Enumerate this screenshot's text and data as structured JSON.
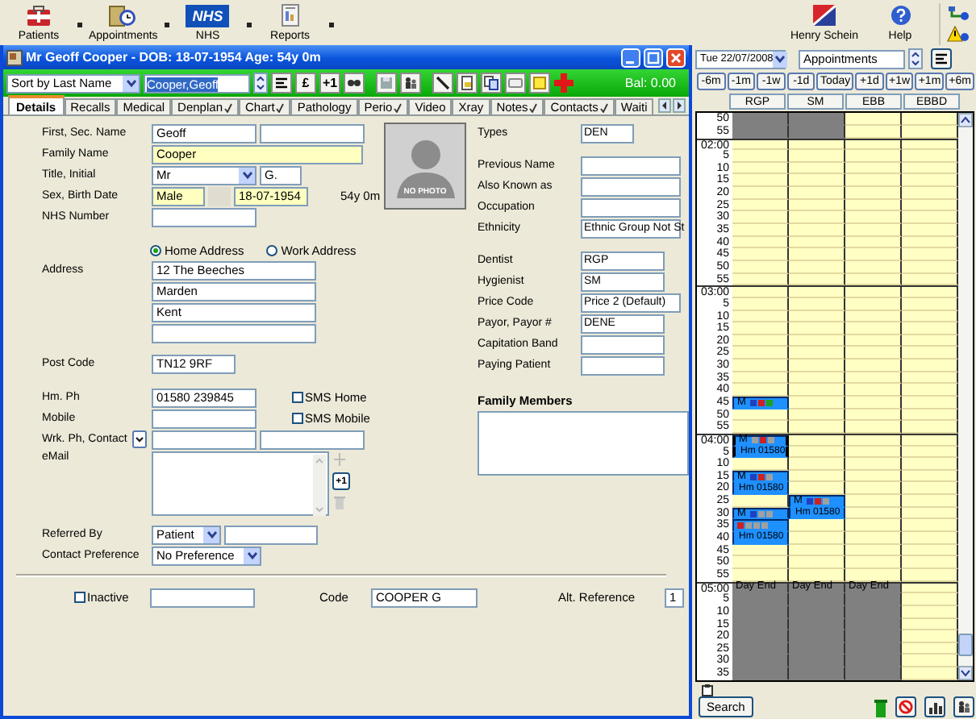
{
  "app_toolbar": {
    "items": [
      {
        "kind": "patients",
        "label": "Patients"
      },
      {
        "kind": "appointments",
        "label": "Appointments"
      },
      {
        "kind": "nhs",
        "logo": "NHS",
        "label": "NHS"
      },
      {
        "kind": "reports",
        "label": "Reports"
      }
    ],
    "brand": "Henry Schein",
    "help": "Help"
  },
  "patient_window": {
    "title": "Mr Geoff Cooper - DOB: 18-07-1954 Age: 54y 0m",
    "sort": "Sort by Last Name",
    "search": "Cooper,Geoff",
    "buttons": [
      {
        "label": "£"
      },
      {
        "label": "+1"
      }
    ],
    "balance": "Bal: 0.00",
    "tabs": [
      {
        "label": "Details",
        "selected": true,
        "ticked": false
      },
      {
        "label": "Recalls",
        "selected": false,
        "ticked": false
      },
      {
        "label": "Medical",
        "selected": false,
        "ticked": false
      },
      {
        "label": "Denplan",
        "selected": false,
        "ticked": true
      },
      {
        "label": "Chart",
        "selected": false,
        "ticked": true
      },
      {
        "label": "Pathology",
        "selected": false,
        "ticked": false
      },
      {
        "label": "Perio",
        "selected": false,
        "ticked": true
      },
      {
        "label": "Video",
        "selected": false,
        "ticked": false
      },
      {
        "label": "Xray",
        "selected": false,
        "ticked": false
      },
      {
        "label": "Notes",
        "selected": false,
        "ticked": true
      },
      {
        "label": "Contacts",
        "selected": false,
        "ticked": true
      },
      {
        "label": "Waiti",
        "selected": false,
        "ticked": false
      }
    ],
    "photo": "NO PHOTO",
    "left_rows": [
      {
        "kind": "fields",
        "label": "First, Sec. Name",
        "fields": [
          {
            "kind": "text",
            "value": "Geoff",
            "required": false
          },
          {
            "kind": "text",
            "required": false
          }
        ]
      },
      {
        "kind": "fields",
        "label": "Family Name",
        "fields": [
          {
            "kind": "text",
            "value": "Cooper",
            "required": true
          }
        ]
      },
      {
        "kind": "fields",
        "label": "Title, Initial",
        "fields": [
          {
            "kind": "dropdown",
            "value": "Mr",
            "required": false
          },
          {
            "kind": "text",
            "value": "G.",
            "required": false
          }
        ]
      },
      {
        "kind": "fields",
        "label": "Sex, Birth Date",
        "fields": [
          {
            "kind": "text",
            "value": "Male",
            "required": true
          },
          {
            "kind": "panel"
          },
          {
            "kind": "text",
            "value": "18-07-1954",
            "required": true
          },
          {
            "kind": "note",
            "value": "54y 0m"
          }
        ]
      },
      {
        "kind": "fields",
        "label": "NHS Number",
        "fields": [
          {
            "kind": "text",
            "required": false
          }
        ]
      },
      {
        "kind": "radios",
        "options": [
          {
            "label": "Home Address",
            "selected": true
          },
          {
            "label": "Work Address",
            "selected": false
          }
        ]
      },
      {
        "kind": "stack",
        "label": "Address",
        "fields": [
          {
            "kind": "text",
            "value": "12 The Beeches",
            "required": false
          },
          {
            "kind": "text",
            "value": "Marden",
            "required": false
          },
          {
            "kind": "text",
            "value": "Kent",
            "required": false
          },
          {
            "kind": "text",
            "required": false
          }
        ]
      },
      {
        "kind": "fields",
        "label": "Post Code",
        "fields": [
          {
            "kind": "text",
            "value": "TN12 9RF",
            "required": false
          }
        ]
      },
      {
        "kind": "fields",
        "label": "Hm. Ph",
        "fields": [
          {
            "kind": "text",
            "value": "01580 239845",
            "required": false
          },
          {
            "kind": "checkbox",
            "label": "SMS Home",
            "checked": false
          }
        ]
      },
      {
        "kind": "fields",
        "label": "Mobile",
        "fields": [
          {
            "kind": "text",
            "required": false
          },
          {
            "kind": "checkbox",
            "label": "SMS Mobile",
            "checked": false
          }
        ]
      },
      {
        "kind": "fields",
        "label": "Wrk. Ph, Contact",
        "fields": [
          {
            "kind": "dropbutton"
          },
          {
            "kind": "text",
            "required": false
          },
          {
            "kind": "text",
            "required": false
          }
        ]
      },
      {
        "kind": "memo",
        "label": "eMail",
        "button": "+1"
      },
      {
        "kind": "fields",
        "label": "Referred By",
        "fields": [
          {
            "kind": "dropdown",
            "value": "Patient",
            "required": false
          },
          {
            "kind": "text",
            "required": false
          }
        ]
      },
      {
        "kind": "fields",
        "label": "Contact Preference",
        "fields": [
          {
            "kind": "dropdown",
            "value": "No Preference",
            "required": false
          }
        ]
      }
    ],
    "right_groups": [
      [
        {
          "label": "Types",
          "value": "DEN"
        }
      ],
      [
        {
          "label": "Previous Name"
        },
        {
          "label": "Also Known as"
        },
        {
          "label": "Occupation"
        },
        {
          "label": "Ethnicity",
          "value": "Ethnic Group Not St"
        }
      ],
      [
        {
          "label": "Dentist",
          "value": "RGP"
        },
        {
          "label": "Hygienist",
          "value": "SM"
        },
        {
          "label": "Price Code",
          "value": "Price 2 (Default)"
        },
        {
          "label": "Payor, Payor #",
          "value": "DENE"
        },
        {
          "label": "Capitation Band"
        },
        {
          "label": "Paying Patient"
        }
      ]
    ],
    "family_members": "Family Members",
    "footer": {
      "inactive": {
        "label": "Inactive",
        "checked": false
      },
      "code_label": "Code",
      "code": "COOPER G",
      "alt_label": "Alt. Reference",
      "alt": "1"
    }
  },
  "appointments_panel": {
    "date": "Tue 22/07/2008",
    "book": "Appointments",
    "nav": [
      "-6m",
      "-1m",
      "-1w",
      "-1d",
      "Today",
      "+1d",
      "+1w",
      "+1m",
      "+6m"
    ],
    "columns": [
      "RGP",
      "SM",
      "EBB",
      "EBBD"
    ],
    "rows": [
      {
        "time": "50",
        "hour": false,
        "cells": [
          {
            "kind": "closed"
          },
          {
            "kind": "closed"
          },
          {
            "kind": "open"
          },
          {
            "kind": "open"
          }
        ]
      },
      {
        "time": "55",
        "hour": false,
        "cells": [
          {
            "kind": "closed"
          },
          {
            "kind": "closed"
          },
          {
            "kind": "open"
          },
          {
            "kind": "open"
          }
        ]
      },
      {
        "time": "02:00",
        "hour": true,
        "cells": [
          {
            "kind": "open"
          },
          {
            "kind": "open"
          },
          {
            "kind": "open"
          },
          {
            "kind": "open"
          }
        ]
      },
      {
        "time": "5",
        "hour": false,
        "cells": [
          {
            "kind": "open"
          },
          {
            "kind": "open"
          },
          {
            "kind": "open"
          },
          {
            "kind": "open"
          }
        ]
      },
      {
        "time": "10",
        "hour": false,
        "cells": [
          {
            "kind": "open"
          },
          {
            "kind": "open"
          },
          {
            "kind": "open"
          },
          {
            "kind": "open"
          }
        ]
      },
      {
        "time": "15",
        "hour": false,
        "cells": [
          {
            "kind": "open"
          },
          {
            "kind": "open"
          },
          {
            "kind": "open"
          },
          {
            "kind": "open"
          }
        ]
      },
      {
        "time": "20",
        "hour": false,
        "cells": [
          {
            "kind": "open"
          },
          {
            "kind": "open"
          },
          {
            "kind": "open"
          },
          {
            "kind": "open"
          }
        ]
      },
      {
        "time": "25",
        "hour": false,
        "cells": [
          {
            "kind": "open"
          },
          {
            "kind": "open"
          },
          {
            "kind": "open"
          },
          {
            "kind": "open"
          }
        ]
      },
      {
        "time": "30",
        "hour": false,
        "cells": [
          {
            "kind": "open"
          },
          {
            "kind": "open"
          },
          {
            "kind": "open"
          },
          {
            "kind": "open"
          }
        ]
      },
      {
        "time": "35",
        "hour": false,
        "cells": [
          {
            "kind": "open"
          },
          {
            "kind": "open"
          },
          {
            "kind": "open"
          },
          {
            "kind": "open"
          }
        ]
      },
      {
        "time": "40",
        "hour": false,
        "cells": [
          {
            "kind": "open"
          },
          {
            "kind": "open"
          },
          {
            "kind": "open"
          },
          {
            "kind": "open"
          }
        ]
      },
      {
        "time": "45",
        "hour": false,
        "cells": [
          {
            "kind": "open"
          },
          {
            "kind": "open"
          },
          {
            "kind": "open"
          },
          {
            "kind": "open"
          }
        ]
      },
      {
        "time": "50",
        "hour": false,
        "cells": [
          {
            "kind": "open"
          },
          {
            "kind": "open"
          },
          {
            "kind": "open"
          },
          {
            "kind": "open"
          }
        ]
      },
      {
        "time": "55",
        "hour": false,
        "cells": [
          {
            "kind": "open"
          },
          {
            "kind": "open"
          },
          {
            "kind": "open"
          },
          {
            "kind": "open"
          }
        ]
      },
      {
        "time": "03:00",
        "hour": true,
        "cells": [
          {
            "kind": "open"
          },
          {
            "kind": "open"
          },
          {
            "kind": "open"
          },
          {
            "kind": "open"
          }
        ]
      },
      {
        "time": "5",
        "hour": false,
        "cells": [
          {
            "kind": "open"
          },
          {
            "kind": "open"
          },
          {
            "kind": "open"
          },
          {
            "kind": "open"
          }
        ]
      },
      {
        "time": "10",
        "hour": false,
        "cells": [
          {
            "kind": "open"
          },
          {
            "kind": "open"
          },
          {
            "kind": "open"
          },
          {
            "kind": "open"
          }
        ]
      },
      {
        "time": "15",
        "hour": false,
        "cells": [
          {
            "kind": "open"
          },
          {
            "kind": "open"
          },
          {
            "kind": "open"
          },
          {
            "kind": "open"
          }
        ]
      },
      {
        "time": "20",
        "hour": false,
        "cells": [
          {
            "kind": "open"
          },
          {
            "kind": "open"
          },
          {
            "kind": "open"
          },
          {
            "kind": "open"
          }
        ]
      },
      {
        "time": "25",
        "hour": false,
        "cells": [
          {
            "kind": "open"
          },
          {
            "kind": "open"
          },
          {
            "kind": "open"
          },
          {
            "kind": "open"
          }
        ]
      },
      {
        "time": "30",
        "hour": false,
        "cells": [
          {
            "kind": "open"
          },
          {
            "kind": "open"
          },
          {
            "kind": "open"
          },
          {
            "kind": "open"
          }
        ]
      },
      {
        "time": "35",
        "hour": false,
        "cells": [
          {
            "kind": "open"
          },
          {
            "kind": "open"
          },
          {
            "kind": "open"
          },
          {
            "kind": "open"
          }
        ]
      },
      {
        "time": "40",
        "hour": false,
        "cells": [
          {
            "kind": "open"
          },
          {
            "kind": "open"
          },
          {
            "kind": "open"
          },
          {
            "kind": "open"
          }
        ]
      },
      {
        "time": "45",
        "hour": false,
        "cells": [
          {
            "kind": "appt",
            "top": true,
            "selected": false,
            "text": "M",
            "icons": [
              {
                "color": "#2040c0"
              },
              {
                "color": "#d02020"
              },
              {
                "color": "#20a020"
              }
            ]
          },
          {
            "kind": "open"
          },
          {
            "kind": "open"
          },
          {
            "kind": "open"
          }
        ]
      },
      {
        "time": "50",
        "hour": false,
        "cells": [
          {
            "kind": "open"
          },
          {
            "kind": "open"
          },
          {
            "kind": "open"
          },
          {
            "kind": "open"
          }
        ]
      },
      {
        "time": "55",
        "hour": false,
        "cells": [
          {
            "kind": "open"
          },
          {
            "kind": "open"
          },
          {
            "kind": "open"
          },
          {
            "kind": "open"
          }
        ]
      },
      {
        "time": "04:00",
        "hour": true,
        "cells": [
          {
            "kind": "appt",
            "top": true,
            "selected": true,
            "text": "M",
            "icons": [
              {
                "color": "#a0a0a0"
              },
              {
                "color": "#d02020"
              },
              {
                "color": "#a0a0a0"
              }
            ]
          },
          {
            "kind": "open"
          },
          {
            "kind": "open"
          },
          {
            "kind": "open"
          }
        ]
      },
      {
        "time": "5",
        "hour": false,
        "cells": [
          {
            "kind": "appt",
            "top": false,
            "selected": true,
            "text": "Hm 01580"
          },
          {
            "kind": "open"
          },
          {
            "kind": "open"
          },
          {
            "kind": "open"
          }
        ]
      },
      {
        "time": "10",
        "hour": false,
        "cells": [
          {
            "kind": "open"
          },
          {
            "kind": "open"
          },
          {
            "kind": "open"
          },
          {
            "kind": "open"
          }
        ]
      },
      {
        "time": "15",
        "hour": false,
        "cells": [
          {
            "kind": "appt",
            "top": true,
            "selected": false,
            "text": "M",
            "icons": [
              {
                "color": "#2040c0"
              },
              {
                "color": "#d02020"
              },
              {
                "color": "#a0a0a0"
              }
            ]
          },
          {
            "kind": "open"
          },
          {
            "kind": "open"
          },
          {
            "kind": "open"
          }
        ]
      },
      {
        "time": "20",
        "hour": false,
        "cells": [
          {
            "kind": "appt",
            "top": false,
            "selected": false,
            "text": "Hm 01580"
          },
          {
            "kind": "open"
          },
          {
            "kind": "open"
          },
          {
            "kind": "open"
          }
        ]
      },
      {
        "time": "25",
        "hour": false,
        "cells": [
          {
            "kind": "open"
          },
          {
            "kind": "appt",
            "top": true,
            "selected": false,
            "text": "M",
            "icons": [
              {
                "color": "#2040c0"
              },
              {
                "color": "#d02020"
              },
              {
                "color": "#a0a0a0"
              }
            ]
          },
          {
            "kind": "open"
          },
          {
            "kind": "open"
          }
        ]
      },
      {
        "time": "30",
        "hour": false,
        "cells": [
          {
            "kind": "appt",
            "top": true,
            "selected": false,
            "text": "M",
            "icons": [
              {
                "color": "#2040c0"
              },
              {
                "color": "#a0a0a0"
              },
              {
                "color": "#a0a0a0"
              }
            ]
          },
          {
            "kind": "appt",
            "top": false,
            "selected": false,
            "text": "Hm 01580"
          },
          {
            "kind": "open"
          },
          {
            "kind": "open"
          }
        ]
      },
      {
        "time": "35",
        "hour": false,
        "cells": [
          {
            "kind": "appt",
            "top": true,
            "selected": false,
            "icons": [
              {
                "color": "#d02020"
              },
              {
                "color": "#a0a0a0"
              },
              {
                "color": "#a0a0a0"
              },
              {
                "color": "#a0a0a0"
              }
            ]
          },
          {
            "kind": "open"
          },
          {
            "kind": "open"
          },
          {
            "kind": "open"
          }
        ]
      },
      {
        "time": "40",
        "hour": false,
        "cells": [
          {
            "kind": "appt",
            "top": false,
            "selected": false,
            "text": "Hm 01580"
          },
          {
            "kind": "open"
          },
          {
            "kind": "open"
          },
          {
            "kind": "open"
          }
        ]
      },
      {
        "time": "45",
        "hour": false,
        "cells": [
          {
            "kind": "open"
          },
          {
            "kind": "open"
          },
          {
            "kind": "open"
          },
          {
            "kind": "open"
          }
        ]
      },
      {
        "time": "50",
        "hour": false,
        "cells": [
          {
            "kind": "open"
          },
          {
            "kind": "open"
          },
          {
            "kind": "open"
          },
          {
            "kind": "open"
          }
        ]
      },
      {
        "time": "55",
        "hour": false,
        "cells": [
          {
            "kind": "open"
          },
          {
            "kind": "open"
          },
          {
            "kind": "open"
          },
          {
            "kind": "open"
          }
        ]
      },
      {
        "time": "05:00",
        "hour": true,
        "cells": [
          {
            "kind": "closed",
            "text": "Day End"
          },
          {
            "kind": "closed",
            "text": "Day End"
          },
          {
            "kind": "closed",
            "text": "Day End"
          },
          {
            "kind": "open"
          }
        ]
      },
      {
        "time": "5",
        "hour": false,
        "cells": [
          {
            "kind": "closed"
          },
          {
            "kind": "closed"
          },
          {
            "kind": "closed"
          },
          {
            "kind": "open"
          }
        ]
      },
      {
        "time": "10",
        "hour": false,
        "cells": [
          {
            "kind": "closed"
          },
          {
            "kind": "closed"
          },
          {
            "kind": "closed"
          },
          {
            "kind": "open"
          }
        ]
      },
      {
        "time": "15",
        "hour": false,
        "cells": [
          {
            "kind": "closed"
          },
          {
            "kind": "closed"
          },
          {
            "kind": "closed"
          },
          {
            "kind": "open"
          }
        ]
      },
      {
        "time": "20",
        "hour": false,
        "cells": [
          {
            "kind": "closed"
          },
          {
            "kind": "closed"
          },
          {
            "kind": "closed"
          },
          {
            "kind": "open"
          }
        ]
      },
      {
        "time": "25",
        "hour": false,
        "cells": [
          {
            "kind": "closed"
          },
          {
            "kind": "closed"
          },
          {
            "kind": "closed"
          },
          {
            "kind": "open"
          }
        ]
      },
      {
        "time": "30",
        "hour": false,
        "cells": [
          {
            "kind": "closed"
          },
          {
            "kind": "closed"
          },
          {
            "kind": "closed"
          },
          {
            "kind": "open"
          }
        ]
      },
      {
        "time": "35",
        "hour": false,
        "cells": [
          {
            "kind": "closed"
          },
          {
            "kind": "closed"
          },
          {
            "kind": "closed"
          },
          {
            "kind": "open"
          }
        ]
      }
    ],
    "search": "Search"
  }
}
